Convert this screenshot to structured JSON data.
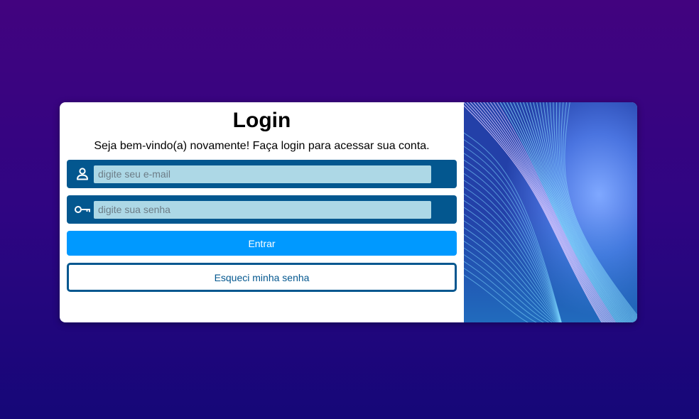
{
  "login": {
    "title": "Login",
    "subtitle": "Seja bem-vindo(a) novamente! Faça login para acessar sua conta.",
    "email": {
      "placeholder": "digite seu e-mail",
      "value": "",
      "icon": "user-icon"
    },
    "password": {
      "placeholder": "digite sua senha",
      "value": "",
      "icon": "key-icon"
    },
    "submit_label": "Entrar",
    "forgot_label": "Esqueci minha senha"
  },
  "colors": {
    "background_top": "#42037f",
    "background_bottom": "#150778",
    "field_bg": "#03578f",
    "input_bg": "#add8e6",
    "primary_button": "#0099ff",
    "secondary_border": "#03578f"
  }
}
